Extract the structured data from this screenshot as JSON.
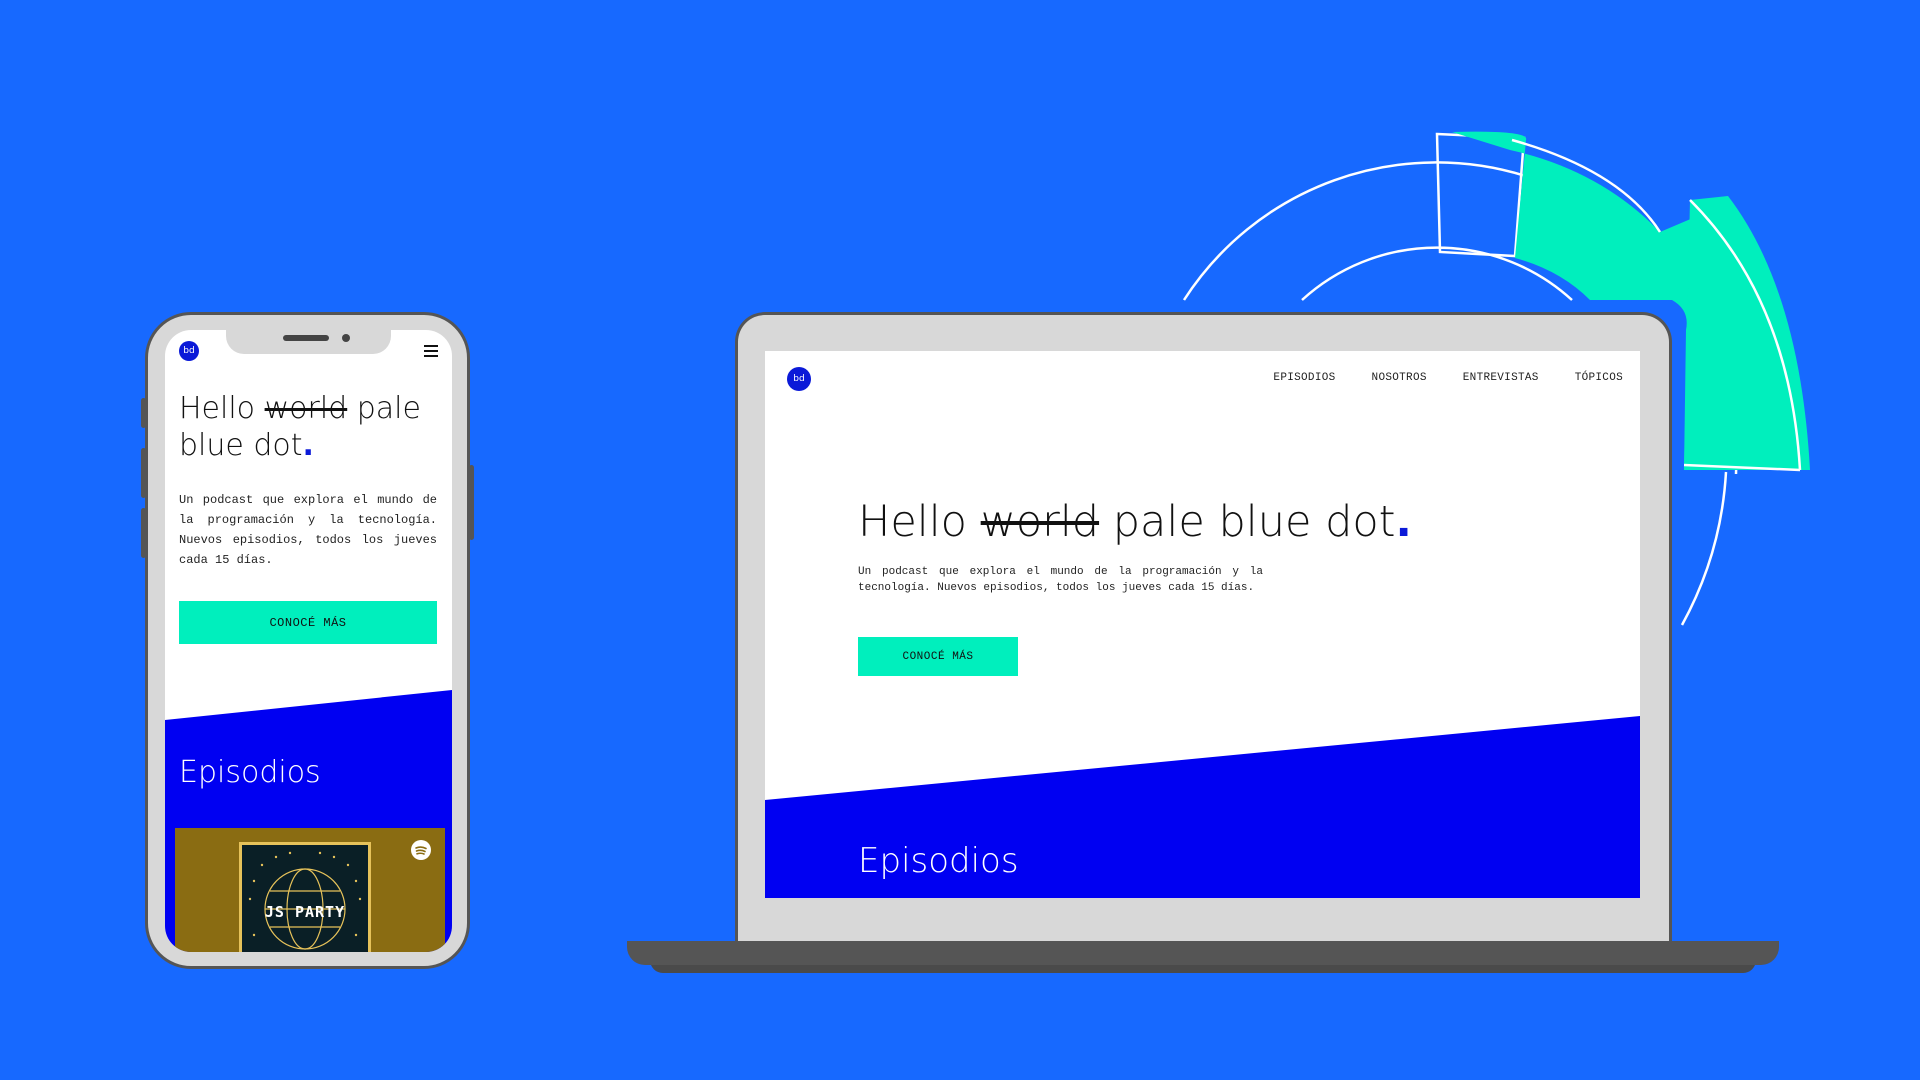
{
  "brand": {
    "logo_text": "bd",
    "accent": "#0b1ad8",
    "cta_color": "#00efbd",
    "background": "#1769ff"
  },
  "hero": {
    "title_hello": "Hello",
    "title_struck": "world",
    "title_rest": "pale blue dot",
    "title_dot": ".",
    "description": "Un podcast que explora el mundo de la programación y la tecnología. Nuevos episodios, todos los jueves cada 15 días.",
    "cta_label": "CONOCÉ MÁS"
  },
  "nav": {
    "items": [
      {
        "label": "EPISODIOS"
      },
      {
        "label": "NOSOTROS"
      },
      {
        "label": "ENTREVISTAS"
      },
      {
        "label": "TÓPICOS"
      }
    ]
  },
  "episodes": {
    "section_title": "Episodios",
    "card": {
      "album_title": "JS PARTY",
      "background": "#8a6c12",
      "service_icon": "spotify-icon"
    }
  },
  "icons": {
    "menu": "hamburger-icon",
    "logo": "logo-icon"
  }
}
